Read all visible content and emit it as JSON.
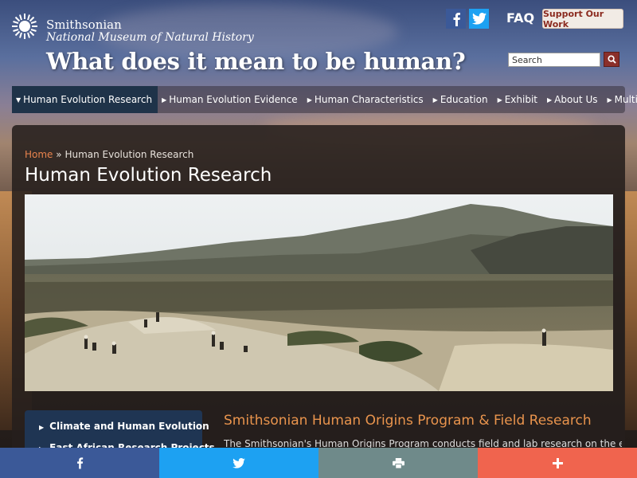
{
  "header": {
    "logo_line1": "Smithsonian",
    "logo_line2": "National Museum of Natural History",
    "site_title": "What does it mean to be human?",
    "faq_label": "FAQ",
    "support_label": "Support Our Work",
    "search_placeholder": "Search"
  },
  "nav": {
    "items": [
      {
        "label": "Human Evolution Research",
        "active": true
      },
      {
        "label": "Human Evolution Evidence"
      },
      {
        "label": "Human Characteristics"
      },
      {
        "label": "Education"
      },
      {
        "label": "Exhibit"
      },
      {
        "label": "About Us"
      },
      {
        "label": "Multimedia"
      }
    ]
  },
  "breadcrumb": {
    "home": "Home",
    "separator": "»",
    "current": "Human Evolution Research"
  },
  "page": {
    "title": "Human Evolution Research",
    "section_title": "Smithsonian Human Origins Program & Field Research",
    "intro": "The Smithsonian's Human Origins Program conducts field and lab research on the evolution"
  },
  "sidebar": {
    "items": [
      {
        "label": "Climate and Human Evolution"
      },
      {
        "label": "East African Research Projects"
      }
    ]
  },
  "share": {
    "icons": [
      "facebook-icon",
      "twitter-icon",
      "print-icon",
      "plus-icon"
    ]
  },
  "colors": {
    "accent_orange": "#e9944d",
    "nav_active": "#1f3349",
    "sidebar_bg": "#1f3553",
    "facebook": "#3b5998",
    "twitter": "#1da1f2",
    "print": "#6f8a8a",
    "more": "#f0644e",
    "support_text": "#8b2a1f"
  }
}
